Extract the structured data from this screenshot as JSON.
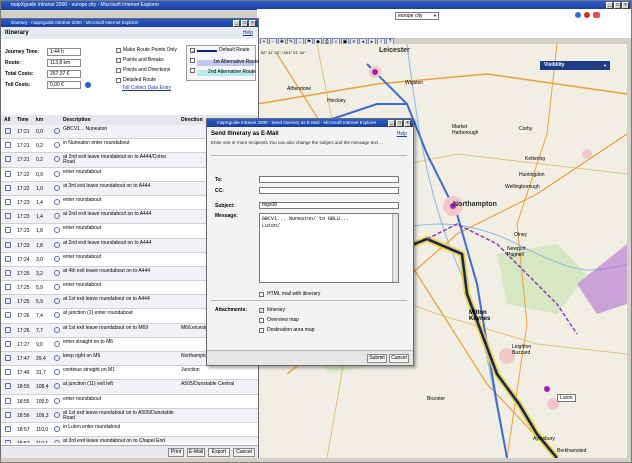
{
  "main_window": {
    "title": "mapXguide Intranet 2000 - europe city - Microsoft Internet Explorer",
    "map_select": "europe city"
  },
  "itinerary_window": {
    "title": "Itinerary - mapXguide Intranet 2000 - Microsoft Internet Explorer",
    "heading": "Itinerary",
    "help": "Help",
    "summary": [
      {
        "label": "Journey Time:",
        "value": "1:44 h"
      },
      {
        "label": "Route:",
        "value": "113,8 km"
      },
      {
        "label": "Total Costs:",
        "value": "267,37 €"
      },
      {
        "label": "Toll Costs:",
        "value": "0,00 €"
      }
    ],
    "options": [
      "Make Route Points Only",
      "Points and Breaks",
      "Points and Directions",
      "Detailed Route",
      "Toll Collect Data Entry"
    ],
    "legend": [
      "Default Route",
      "1st Alternative Route",
      "2nd Alternative Route"
    ],
    "columns": {
      "time": "Time",
      "km": "km",
      "desc": "Description",
      "dir": "Direction"
    },
    "rows": [
      {
        "time": "17:21",
        "km": "0,0",
        "desc": "GBCV1... Nuneaton",
        "dir": ""
      },
      {
        "time": "17:21",
        "km": "0,2",
        "desc": "in Nuneaton enter roundabout",
        "dir": ""
      },
      {
        "time": "17:21",
        "km": "0,2",
        "desc": "at 2nd exit leave roundabout on to A444/Coton Road",
        "dir": ""
      },
      {
        "time": "17:22",
        "km": "0,9",
        "desc": "enter roundabout",
        "dir": ""
      },
      {
        "time": "17:22",
        "km": "1,0",
        "desc": "at 3rd exit leave roundabout on to A444",
        "dir": ""
      },
      {
        "time": "17:23",
        "km": "1,4",
        "desc": "enter roundabout",
        "dir": ""
      },
      {
        "time": "17:23",
        "km": "1,4",
        "desc": "at 2nd exit leave roundabout on to A444",
        "dir": ""
      },
      {
        "time": "17:23",
        "km": "1,8",
        "desc": "enter roundabout",
        "dir": ""
      },
      {
        "time": "17:23",
        "km": "1,8",
        "desc": "at 2nd exit leave roundabout on to A444",
        "dir": ""
      },
      {
        "time": "17:24",
        "km": "3,0",
        "desc": "enter roundabout",
        "dir": ""
      },
      {
        "time": "17:25",
        "km": "3,2",
        "desc": "at 4th exit leave roundabout on to A444",
        "dir": ""
      },
      {
        "time": "17:25",
        "km": "5,9",
        "desc": "enter roundabout",
        "dir": ""
      },
      {
        "time": "17:25",
        "km": "5,9",
        "desc": "at 1st exit leave roundabout on to A444",
        "dir": ""
      },
      {
        "time": "17:26",
        "km": "7,4",
        "desc": "at junction (1) enter roundabout",
        "dir": ""
      },
      {
        "time": "17:26",
        "km": "7,7",
        "desc": "at 1st exit leave roundabout on to M69",
        "dir": "M6/Leicester"
      },
      {
        "time": "17:27",
        "km": "9,0",
        "desc": "enter straight on to M6",
        "dir": ""
      },
      {
        "time": "17:47",
        "km": "29,4",
        "desc": "keep right on M6",
        "dir": "Northampton/ The South"
      },
      {
        "time": "17:49",
        "km": "31,7",
        "desc": "continue straight on M1",
        "dir": "Junction"
      },
      {
        "time": "18:55",
        "km": "108,4",
        "desc": "at junction (11) exit left",
        "dir": "A505/Dunstable Central"
      },
      {
        "time": "18:55",
        "km": "109,0",
        "desc": "enter roundabout",
        "dir": ""
      },
      {
        "time": "18:56",
        "km": "109,3",
        "desc": "at 1st exit leave roundabout on to A505/Dunstable Road",
        "dir": ""
      },
      {
        "time": "18:57",
        "km": "110,0",
        "desc": "in Luton enter roundabout",
        "dir": ""
      },
      {
        "time": "18:57",
        "km": "110,1",
        "desc": "at 3rd exit leave roundabout on to Chapel End Lane",
        "dir": ""
      }
    ],
    "buttons": {
      "print": "Print",
      "email": "E-Mail",
      "export": "Export",
      "cancel": "Cancel"
    }
  },
  "email_dialog": {
    "title": "mapXguide Intranet 2000 - Send Itinerary as E-Mail - Microsoft Internet Explorer",
    "heading": "Send Itinerary as E-Mail",
    "help": "Help",
    "intro": "Enter one or more recipients.You can also change the subject and the message text ...",
    "to_label": "To:",
    "cc_label": "CC:",
    "subject_label": "Subject:",
    "subject_value": "mgx08",
    "message_label": "Message:",
    "message_value": "GBCV1... Nuneaton/ to GBLU...\nLuton/",
    "html_mail": "HTML mail with itinerary",
    "attachments_label": "Attachments:",
    "attachments": [
      "Itinerary",
      "Overview map",
      "Destination area map"
    ],
    "submit": "Submit",
    "cancel": "Cancel"
  },
  "map": {
    "coords": "52° 41' 53'' / 001° 01' 34''",
    "visibility": "Visibility",
    "cities": [
      "Leicester",
      "Atherstone",
      "Hinckley",
      "Wigston",
      "Market Harborough",
      "Corby",
      "Kettering",
      "Huntingdon",
      "Wellingborough",
      "Northampton",
      "Olney",
      "Newport Pagnell",
      "Milton Keynes",
      "Leighton Buzzard",
      "Luton",
      "Aylesbury",
      "Bicester",
      "Berkhamsted"
    ]
  },
  "colors": {
    "titlebar": "#1a3f9e",
    "route": "#0d1e8c",
    "route_highlight": "#f0d000",
    "motorway": "#3a6bd6"
  }
}
